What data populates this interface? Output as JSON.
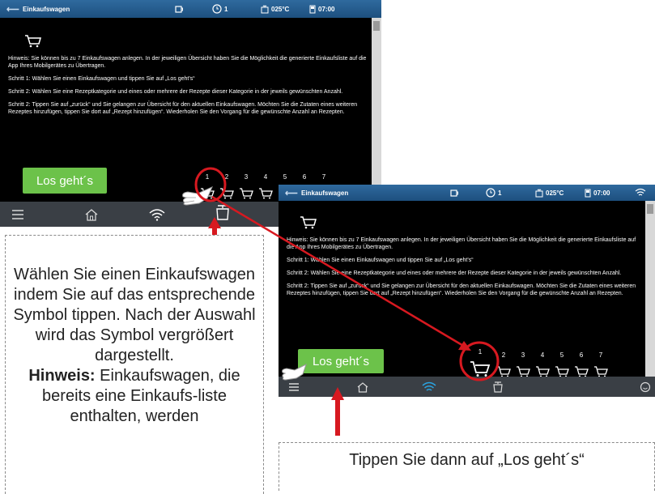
{
  "screens": [
    {
      "title": "Einkaufswagen",
      "status": {
        "count": "1",
        "temp": "025°C",
        "time": "07:00"
      },
      "texts": [
        "Hinweis: Sie können bis zu 7 Einkaufswagen anlegen. In der jeweiligen Übersicht haben Sie die Möglichkeit die generierte Einkaufsliste auf die App Ihres Mobilgerätes zu Übertragen.",
        "Schritt 1: Wählen Sie einen Einkaufswagen und tippen Sie auf „Los geht's“",
        "Schritt 2: Wählen Sie eine Rezeptkategorie und eines oder mehrere der Rezepte dieser Kategorie in der jeweils gewünschten Anzahl.",
        "Schritt 2: Tippen Sie auf „zurück“ und Sie gelangen zur Übersicht für den aktuellen Einkaufswagen. Möchten Sie die Zutaten eines weiteren Rezeptes hinzufügen, tippen Sie dort auf „Rezept hinzufügen“. Wiederholen Sie den Vorgang für die gewünschte Anzahl an Rezepten."
      ],
      "go_button": "Los geht´s",
      "cart_numbers": [
        "1",
        "2",
        "3",
        "4",
        "5",
        "6",
        "7"
      ]
    },
    {
      "title": "Einkaufswagen",
      "status": {
        "count": "1",
        "temp": "025°C",
        "time": "07:00"
      },
      "texts": [
        "Hinweis: Sie können bis zu 7 Einkaufswagen anlegen. In der jeweiligen Übersicht haben Sie die Möglichkeit die generierte Einkaufsliste auf die App Ihres Mobilgerätes zu Übertragen.",
        "Schritt 1: Wählen Sie einen Einkaufswagen und tippen Sie auf „Los geht's“",
        "Schritt 2: Wählen Sie eine Rezeptkategorie und eines oder mehrere der Rezepte dieser Kategorie in der jeweils gewünschten Anzahl.",
        "Schritt 2: Tippen Sie auf „zurück“ und Sie gelangen zur Übersicht für den aktuellen Einkaufswagen. Möchten Sie die Zutaten eines weiteren Rezeptes hinzufügen, tippen Sie dort auf „Rezept hinzufügen“. Wiederholen Sie den Vorgang für die gewünschte Anzahl an Rezepten."
      ],
      "go_button": "Los geht´s",
      "cart_numbers": [
        "1",
        "2",
        "3",
        "4",
        "5",
        "6",
        "7"
      ]
    }
  ],
  "callout1": {
    "text": "Wählen Sie einen Einkaufswagen indem Sie auf das entsprechende Symbol tippen. Nach der Auswahl wird das Symbol vergrößert dargestellt.",
    "hint_label": "Hinweis:",
    "hint_text": "Einkaufswagen, die bereits eine Einkaufs-liste enthalten, werden"
  },
  "callout2": {
    "text": "Tippen Sie dann auf „Los geht´s“"
  },
  "colors": {
    "accent_red": "#d71920",
    "button_green": "#6cc24a",
    "titlebar_blue": "#1d4f7e",
    "wifi_blue": "#2aa3e0"
  }
}
